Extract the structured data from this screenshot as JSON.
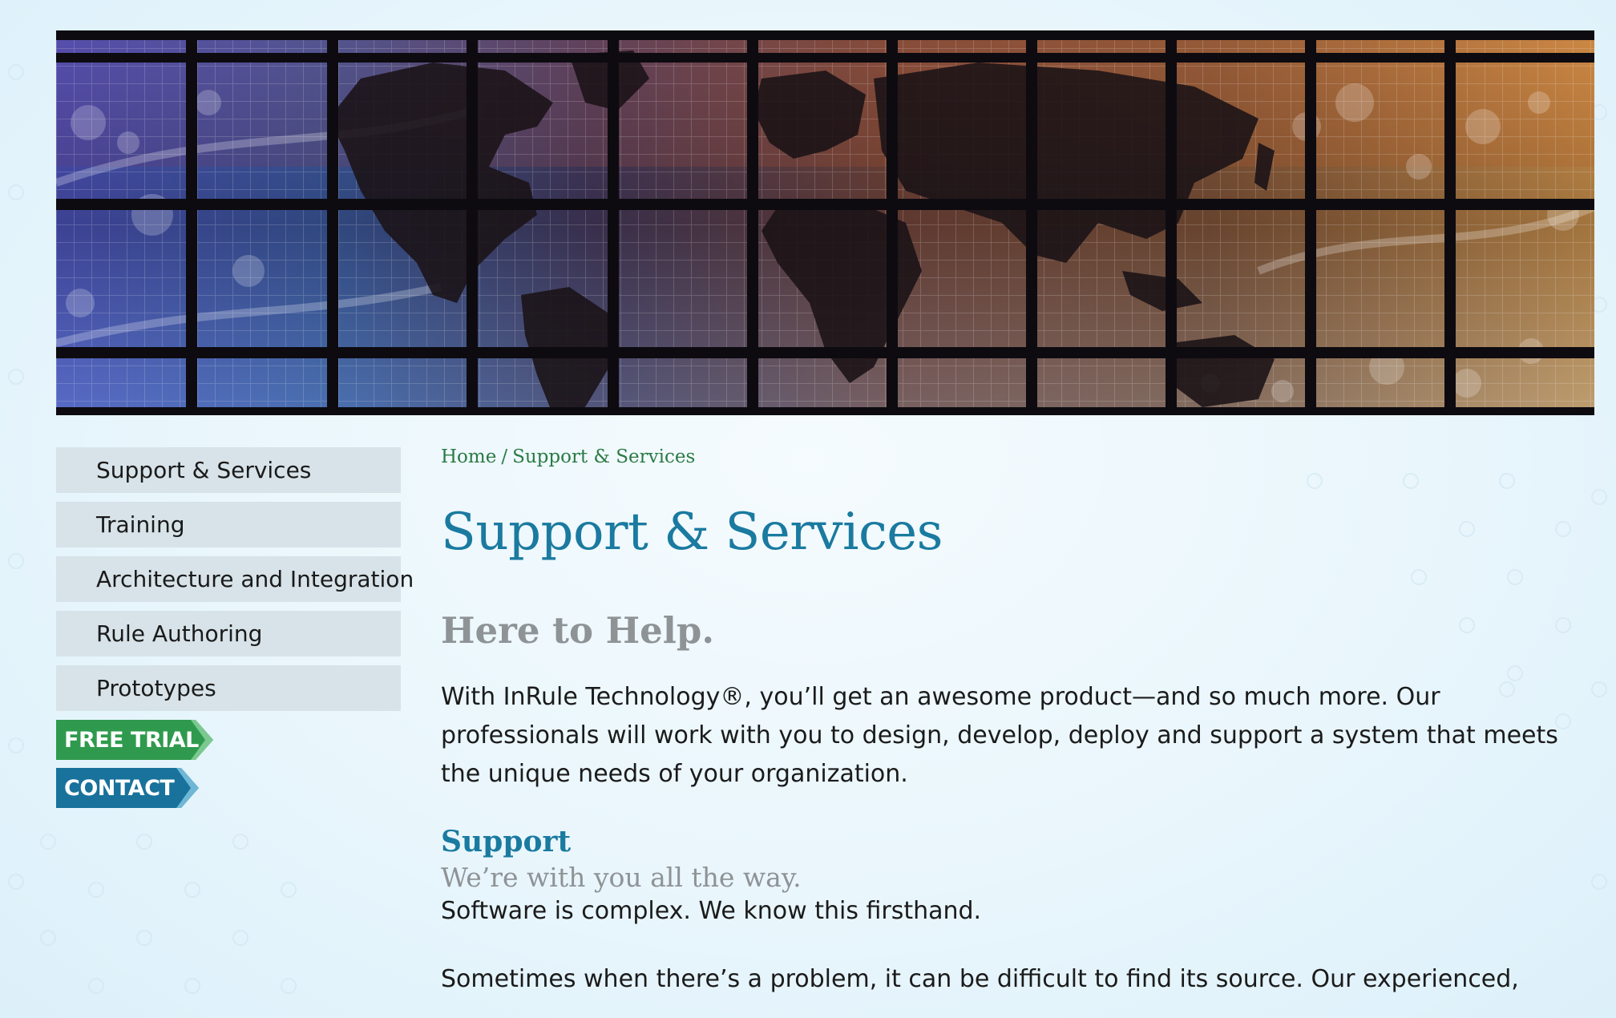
{
  "banner": {
    "image_alt": "World map on a grid of illuminated screens",
    "colors": [
      "#5b5fc9",
      "#3c7fc0",
      "#6a4b8a",
      "#b46a4a",
      "#e0a25a"
    ]
  },
  "sidebar": {
    "items": [
      {
        "label": "Support & Services"
      },
      {
        "label": "Training"
      },
      {
        "label": "Architecture and Integration"
      },
      {
        "label": "Rule Authoring"
      },
      {
        "label": "Prototypes"
      }
    ],
    "free_trial_label": "FREE TRIAL",
    "contact_label": "CONTACT"
  },
  "breadcrumb": {
    "home": "Home",
    "separator": "/",
    "current": "Support & Services"
  },
  "main": {
    "title": "Support & Services",
    "subtitle": "Here to Help.",
    "intro": "With InRule Technology®, you’ll get an awesome product—and so much more. Our professionals will work with you to design, develop, deploy and support a system that meets the unique needs of your organization.",
    "support": {
      "heading": "Support",
      "subheading": "We’re with you all the way.",
      "para1": "Software is complex. We know this firsthand.",
      "para2": "Sometimes when there’s a problem, it can be difficult to find its source. Our experienced,"
    }
  },
  "colors": {
    "title_blue": "#1a7aa0",
    "breadcrumb_green": "#2a7a44",
    "subtitle_gray": "#8e9396",
    "nav_bg": "#d7e3e9",
    "free_trial_green": "#2f9a4d",
    "contact_blue": "#18729b"
  }
}
